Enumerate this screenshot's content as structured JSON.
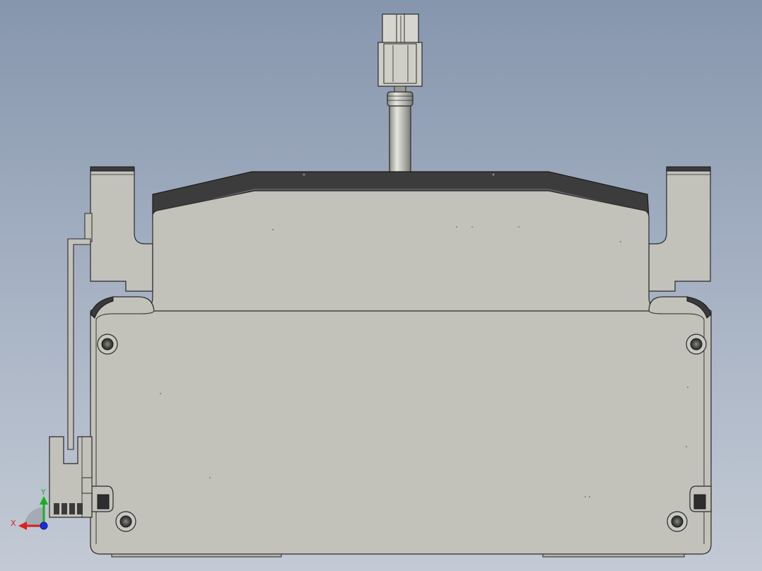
{
  "viewport": {
    "background_top": "#8696ad",
    "background_bottom": "#c3cad5"
  },
  "model": {
    "body_fill": "#c2c2ba",
    "body_fill_dark": "#b4b4ac",
    "edge_color": "#2a2a2a",
    "top_cover_fill": "#3a3a3a",
    "shaft_fill": "#b8b8b2",
    "connector_fill": "#cfcfc8"
  },
  "triad": {
    "x_label": "X",
    "y_label": "Y",
    "x_color": "#e0201c",
    "y_color": "#18b020",
    "z_color": "#1a2fd8"
  }
}
